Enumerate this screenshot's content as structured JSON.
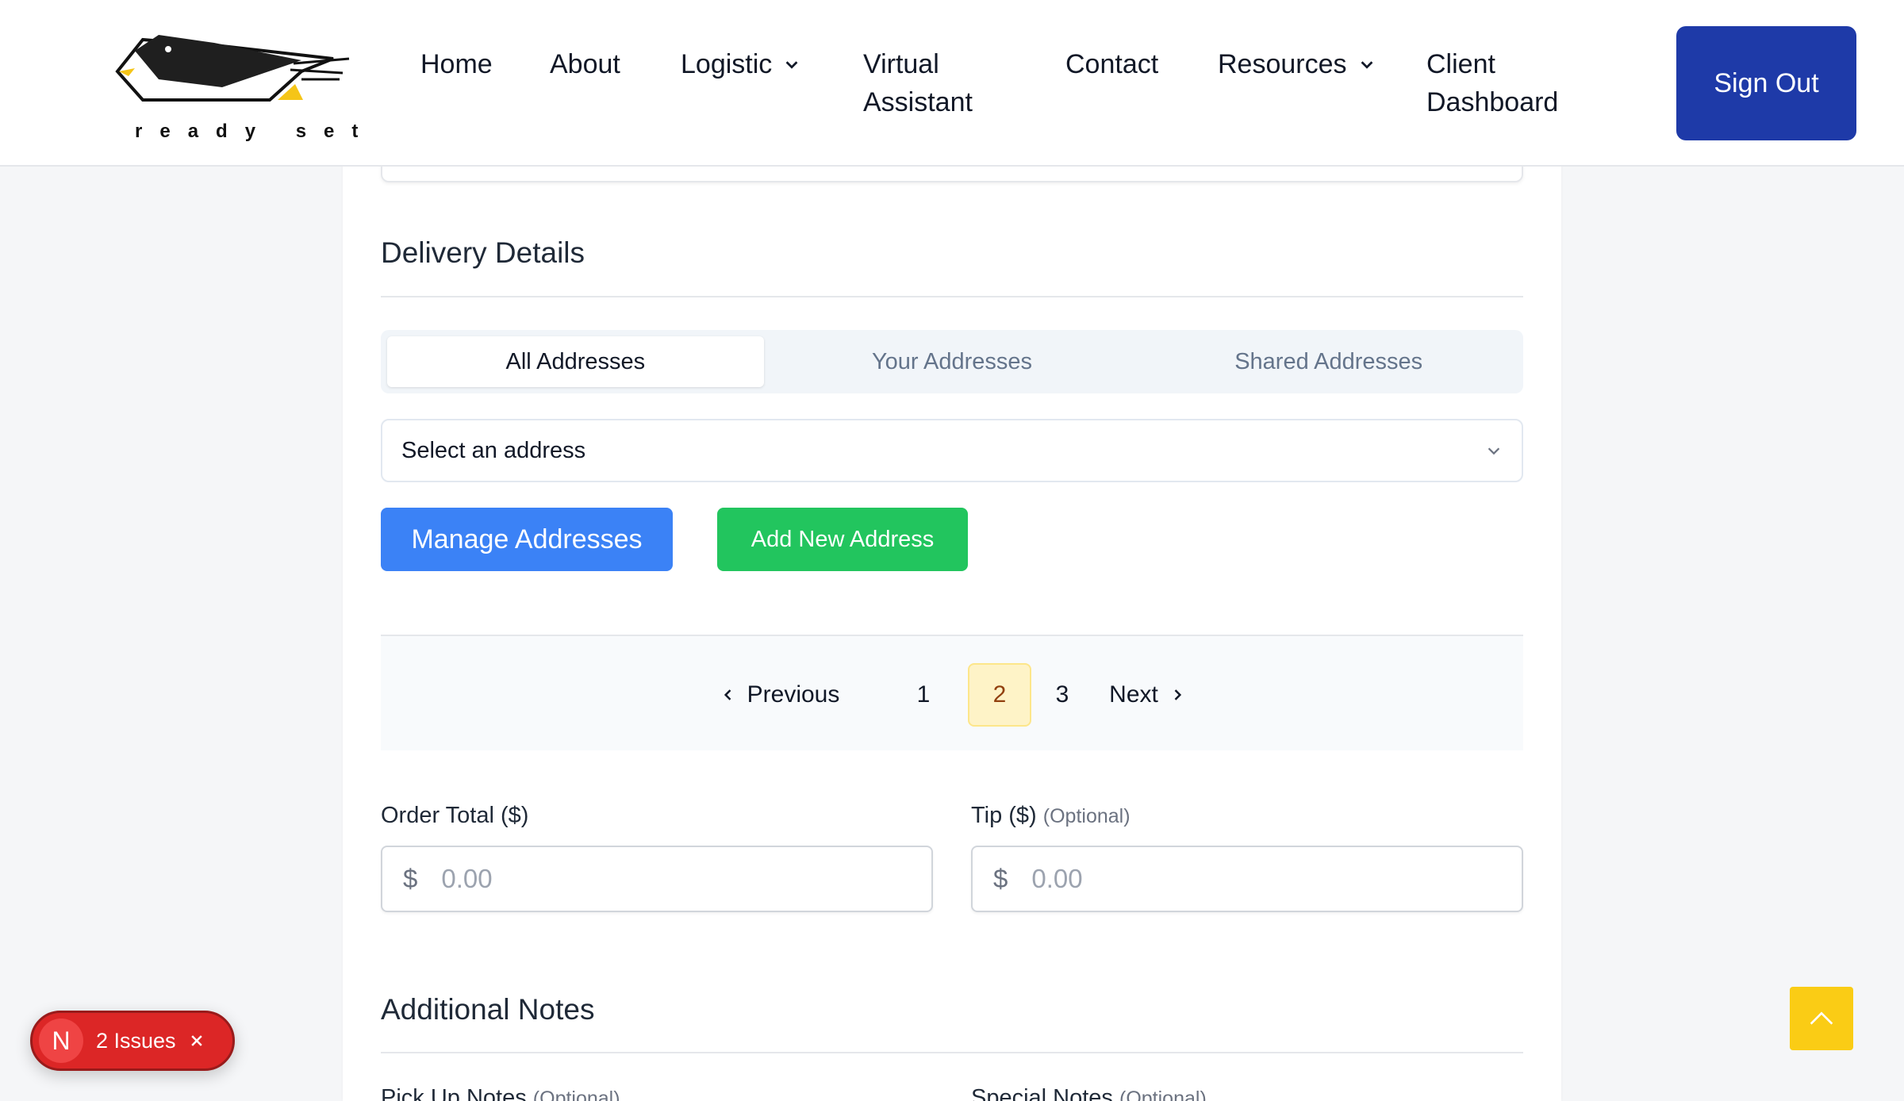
{
  "brand": {
    "logo_text": "ready set"
  },
  "nav": {
    "home": "Home",
    "about": "About",
    "logistic": "Logistic",
    "virtual_assistant": "Virtual Assistant",
    "contact": "Contact",
    "resources": "Resources",
    "client_dashboard": "Client Dashboard",
    "sign_out": "Sign Out"
  },
  "delivery": {
    "title": "Delivery Details",
    "tabs": [
      "All Addresses",
      "Your Addresses",
      "Shared Addresses"
    ],
    "active_tab": "All Addresses",
    "select_value": "Select an address",
    "manage_button": "Manage Addresses",
    "add_button": "Add New Address"
  },
  "pagination": {
    "previous": "Previous",
    "pages": [
      "1",
      "2",
      "3"
    ],
    "current": "2",
    "next": "Next"
  },
  "payment": {
    "order_total_label": "Order Total ($)",
    "tip_label": "Tip ($)",
    "tip_optional": "(Optional)",
    "currency_symbol": "$",
    "order_total_placeholder": "0.00",
    "tip_placeholder": "0.00"
  },
  "notes": {
    "title": "Additional Notes",
    "pickup_label": "Pick Up Notes",
    "special_label": "Special Notes",
    "optional": "(Optional)"
  },
  "issues_badge": {
    "initial": "N",
    "text": "2 Issues"
  },
  "colors": {
    "sign_out_bg": "#1e3aa8",
    "manage_bg": "#3b82f6",
    "add_bg": "#22c55e",
    "issues_bg": "#dc2626",
    "to_top_bg": "#facc15",
    "active_page_bg": "#fef3c7"
  }
}
